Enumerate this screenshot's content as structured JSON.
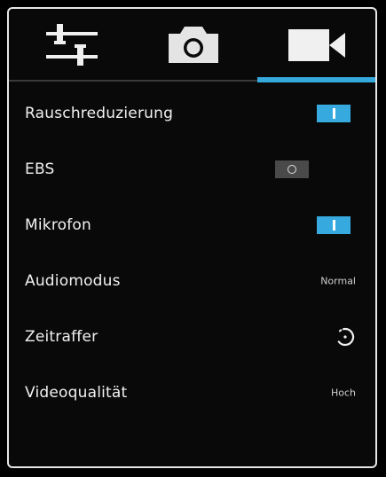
{
  "tabs": [
    {
      "icon": "settings-sliders-icon",
      "selected": false
    },
    {
      "icon": "camera-icon",
      "selected": false
    },
    {
      "icon": "video-camera-icon",
      "selected": true
    }
  ],
  "accent_color": "#35a8dc",
  "settings": {
    "noise_reduction": {
      "label": "Rauschreduzierung",
      "enabled": true
    },
    "ebs": {
      "label": "EBS",
      "enabled": false
    },
    "microphone": {
      "label": "Mikrofon",
      "enabled": true
    },
    "audio_mode": {
      "label": "Audiomodus",
      "value": "Normal"
    },
    "time_lapse": {
      "label": "Zeitraffer",
      "icon": "timer-icon"
    },
    "video_quality": {
      "label": "Videoqualität",
      "value": "Hoch"
    }
  }
}
